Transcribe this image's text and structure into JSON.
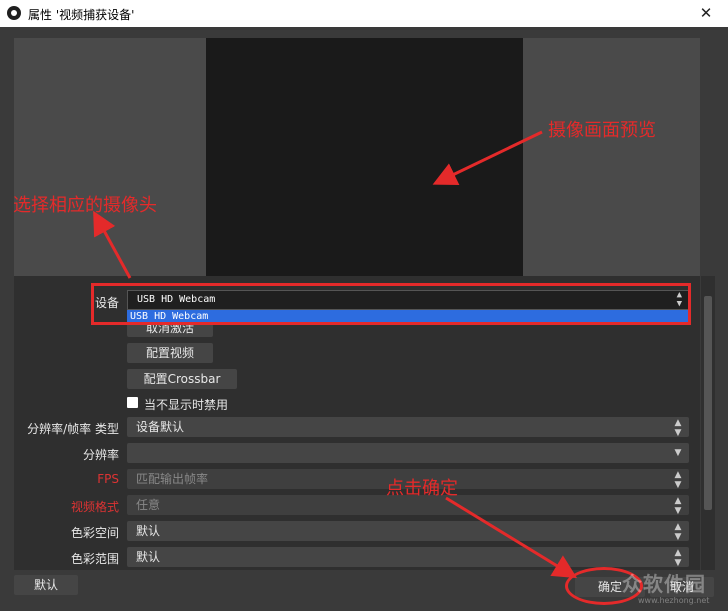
{
  "window": {
    "title": "属性 '视频捕获设备'",
    "close_label": "✕"
  },
  "annotations": {
    "preview_label": "摄像画面预览",
    "select_camera": "选择相应的摄像头",
    "click_ok": "点击确定",
    "color": "#e42a2a"
  },
  "device": {
    "label": "设备",
    "selected": "USB HD Webcam",
    "options": [
      "USB HD Webcam"
    ]
  },
  "buttons": {
    "deactivate": "取消激活",
    "configure_video": "配置视频",
    "configure_crossbar": "配置Crossbar",
    "defaults": "默认",
    "ok": "确定",
    "cancel": "取消"
  },
  "checkbox": {
    "label": "当不显示时禁用",
    "checked": false
  },
  "fields": [
    {
      "label": "分辨率/帧率 类型",
      "value": "设备默认",
      "red": false,
      "dim": false
    },
    {
      "label": "分辨率",
      "value": "",
      "red": false,
      "dim": false
    },
    {
      "label": "FPS",
      "value": "匹配输出帧率",
      "red": true,
      "dim": true
    },
    {
      "label": "视频格式",
      "value": "任意",
      "red": true,
      "dim": true
    },
    {
      "label": "色彩空间",
      "value": "默认",
      "red": false,
      "dim": false
    },
    {
      "label": "色彩范围",
      "value": "默认",
      "red": false,
      "dim": false
    }
  ],
  "watermark": {
    "text": "众软件园",
    "url": "www.hezhong.net"
  }
}
